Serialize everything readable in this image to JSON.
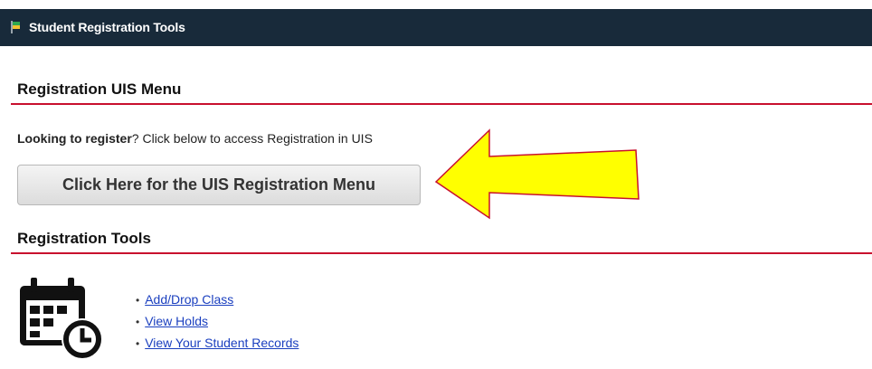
{
  "window": {
    "title": "Student Registration Tools"
  },
  "section_uis": {
    "heading": "Registration UIS Menu"
  },
  "intro": {
    "bold": "Looking to register",
    "rest": "? Click below to access Registration in UIS"
  },
  "button": {
    "label": "Click Here for the UIS Registration Menu"
  },
  "section_tools": {
    "heading": "Registration Tools"
  },
  "links": [
    {
      "label": "Add/Drop Class"
    },
    {
      "label": "View Holds"
    },
    {
      "label": "View Your Student Records"
    }
  ],
  "icons": {
    "title": "flag-icon",
    "tools": "calendar-clock-icon",
    "annotation": "yellow-arrow"
  },
  "colors": {
    "titlebar": "#182a3a",
    "rule": "#c8102e",
    "link": "#1a3fbf",
    "arrow": "#ffff00"
  }
}
